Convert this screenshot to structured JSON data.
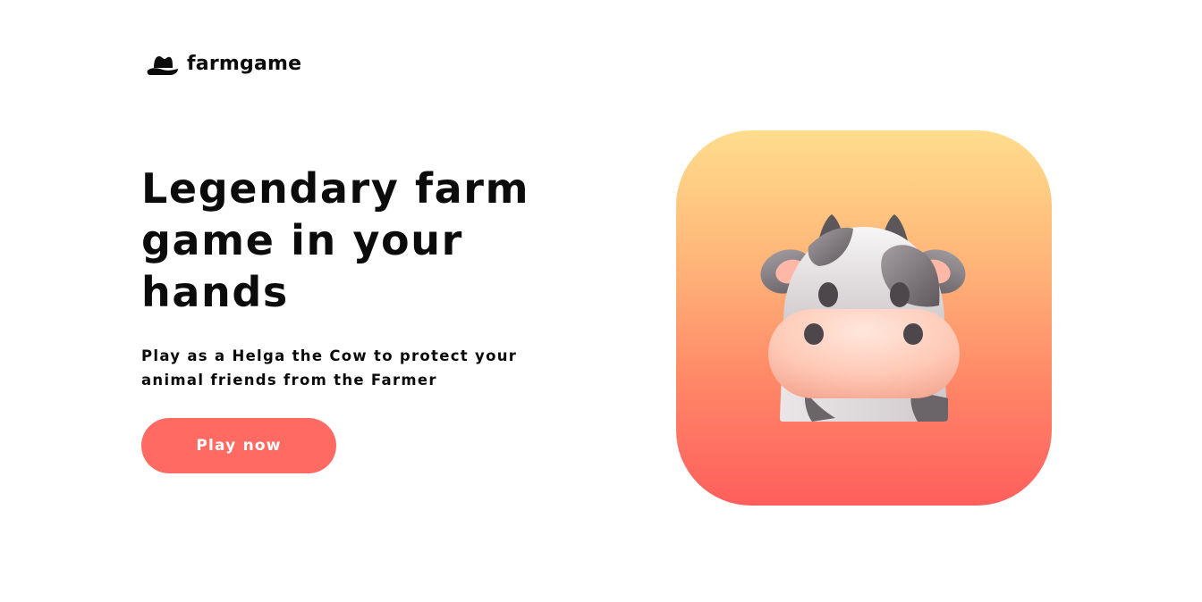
{
  "brand": {
    "name": "farmgame",
    "icon": "farmer-hat-icon"
  },
  "hero": {
    "headline": "Legendary farm game in your hands",
    "subtitle": "Play as a Helga the Cow to protect your animal friends from the Farmer",
    "cta_label": "Play now"
  },
  "illustration": {
    "icon": "cow-icon"
  },
  "colors": {
    "accent": "#ff6b63",
    "tile_gradient_top": "#ffdd8d",
    "tile_gradient_bottom": "#ff5e5c",
    "text": "#0b0b0b",
    "background": "#ffffff"
  }
}
